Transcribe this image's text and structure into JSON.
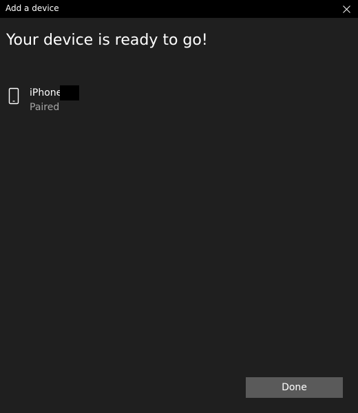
{
  "window": {
    "title": "Add a device",
    "close_icon": "close-icon"
  },
  "main": {
    "heading": "Your device is ready to go!",
    "device": {
      "icon": "phone-icon",
      "name": "iPhone",
      "status": "Paired"
    }
  },
  "footer": {
    "done_label": "Done"
  },
  "colors": {
    "background": "#1f1f1f",
    "titlebar": "#000000",
    "secondary_text": "#a6a6a6",
    "button": "#5a5a5a"
  }
}
